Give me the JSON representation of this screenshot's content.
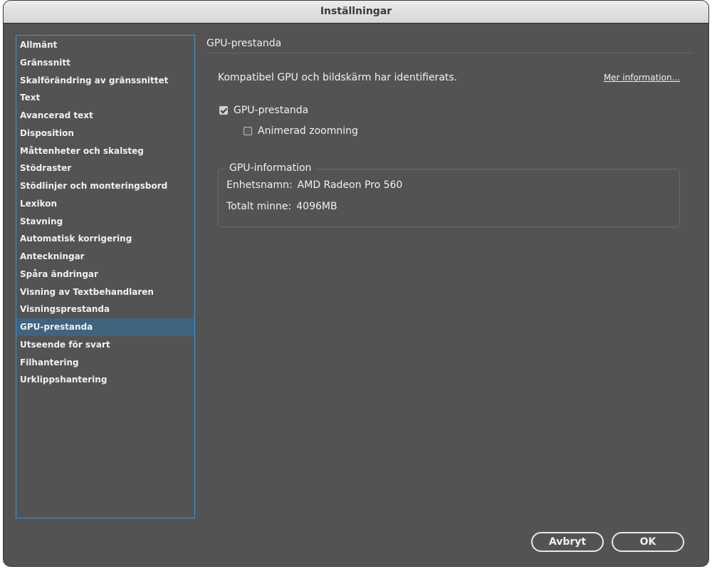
{
  "window": {
    "title": "Inställningar"
  },
  "sidebar": {
    "items": [
      {
        "label": "Allmänt"
      },
      {
        "label": "Gränssnitt"
      },
      {
        "label": "Skalförändring av gränssnittet"
      },
      {
        "label": "Text"
      },
      {
        "label": "Avancerad text"
      },
      {
        "label": "Disposition"
      },
      {
        "label": "Måttenheter och skalsteg"
      },
      {
        "label": "Stödraster"
      },
      {
        "label": "Stödlinjer och monteringsbord"
      },
      {
        "label": "Lexikon"
      },
      {
        "label": "Stavning"
      },
      {
        "label": "Automatisk korrigering"
      },
      {
        "label": "Anteckningar"
      },
      {
        "label": "Spåra ändringar"
      },
      {
        "label": "Visning av Textbehandlaren"
      },
      {
        "label": "Visningsprestanda"
      },
      {
        "label": "GPU-prestanda"
      },
      {
        "label": "Utseende för svart"
      },
      {
        "label": "Filhantering"
      },
      {
        "label": "Urklippshantering"
      }
    ],
    "selected_index": 16
  },
  "panel": {
    "title": "GPU-prestanda",
    "status_text": "Kompatibel GPU och bildskärm har identifierats.",
    "more_link": "Mer information...",
    "gpu_performance": {
      "label": "GPU-prestanda",
      "checked": true
    },
    "animated_zoom": {
      "label": "Animerad zoomning",
      "checked": false
    },
    "gpu_info": {
      "legend": "GPU-information",
      "device_label": "Enhetsnamn:",
      "device_value": "AMD Radeon Pro 560",
      "memory_label": "Totalt minne:",
      "memory_value": "4096MB"
    }
  },
  "buttons": {
    "cancel": "Avbryt",
    "ok": "OK"
  }
}
